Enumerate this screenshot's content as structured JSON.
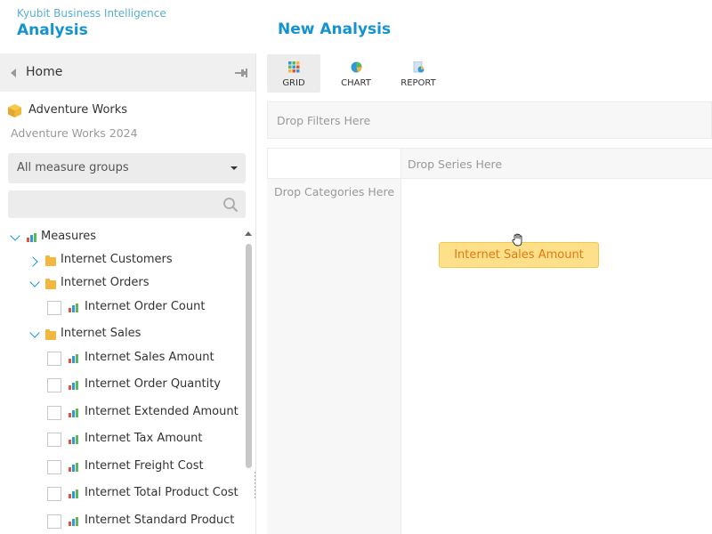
{
  "app": {
    "subtitle": "Kyubit Business Intelligence",
    "title": "Analysis",
    "analysis_title": "New Analysis"
  },
  "sidebar": {
    "home_label": "Home",
    "cube_name": "Adventure Works",
    "cube_subtitle": "Adventure Works 2024",
    "measure_group_select": "All measure groups",
    "search_placeholder": ""
  },
  "tree": {
    "measures_label": "Measures",
    "groups": [
      {
        "label": "Internet Customers",
        "expanded": false
      },
      {
        "label": "Internet Orders",
        "expanded": true,
        "items": [
          "Internet Order Count"
        ]
      },
      {
        "label": "Internet Sales",
        "expanded": true,
        "items": [
          "Internet Sales Amount",
          "Internet Order Quantity",
          "Internet Extended Amount",
          "Internet Tax Amount",
          "Internet Freight Cost",
          "Internet Total Product Cost",
          "Internet Standard Product"
        ]
      }
    ]
  },
  "toolbar": {
    "grid_label": "GRID",
    "chart_label": "CHART",
    "report_label": "REPORT"
  },
  "drop_zones": {
    "filters": "Drop Filters Here",
    "series": "Drop Series Here",
    "categories": "Drop Categories Here"
  },
  "drag": {
    "chip_label": "Internet Sales Amount"
  },
  "colors": {
    "accent": "#1493d0",
    "folder": "#f4b73e",
    "drag_chip_bg": "#ffe08a",
    "drag_chip_text": "#e07a12"
  }
}
